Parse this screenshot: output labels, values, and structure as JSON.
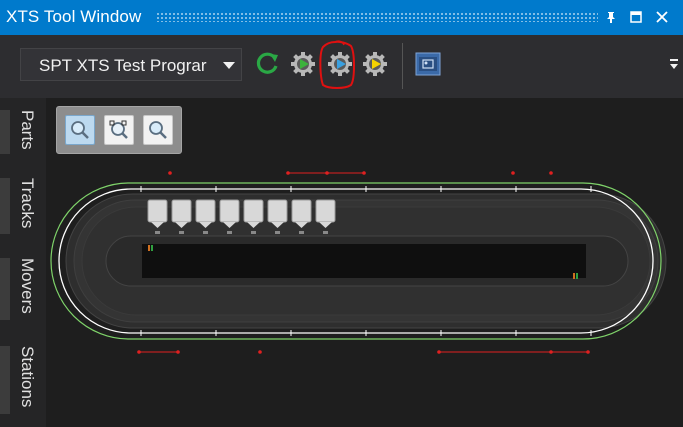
{
  "window": {
    "title": "XTS Tool Window",
    "pin_icon": "pin-icon",
    "maximize_icon": "maximize-icon",
    "close_icon": "close-icon"
  },
  "toolbar": {
    "project_combo": {
      "selected": "SPT XTS Test Prograr"
    },
    "buttons": [
      {
        "name": "refresh",
        "icon": "refresh-icon",
        "color": "#2aa845"
      },
      {
        "name": "run-green",
        "icon": "gear-play-green-icon",
        "color": "#3cb33c"
      },
      {
        "name": "run-blue",
        "icon": "gear-play-blue-icon",
        "color": "#3aa0e0",
        "highlighted": true
      },
      {
        "name": "run-yellow",
        "icon": "gear-play-yellow-icon",
        "color": "#f5d300"
      },
      {
        "name": "viewer",
        "icon": "viewer-icon",
        "color": "#3b6aa8"
      }
    ],
    "annotation_color": "#e01010"
  },
  "sidebar": {
    "tabs": [
      {
        "label": "Parts"
      },
      {
        "label": "Tracks"
      },
      {
        "label": "Movers"
      },
      {
        "label": "Stations"
      }
    ]
  },
  "zoom": {
    "buttons": [
      {
        "icon": "zoom-fit-icon",
        "active": true
      },
      {
        "icon": "zoom-reset-icon",
        "active": false
      },
      {
        "icon": "zoom-in-icon",
        "active": false
      }
    ]
  },
  "track": {
    "outer_line_color": "#7fd36a",
    "inner_line_color": "#ffffff",
    "marker_color": "#e02020",
    "movers": 8
  }
}
